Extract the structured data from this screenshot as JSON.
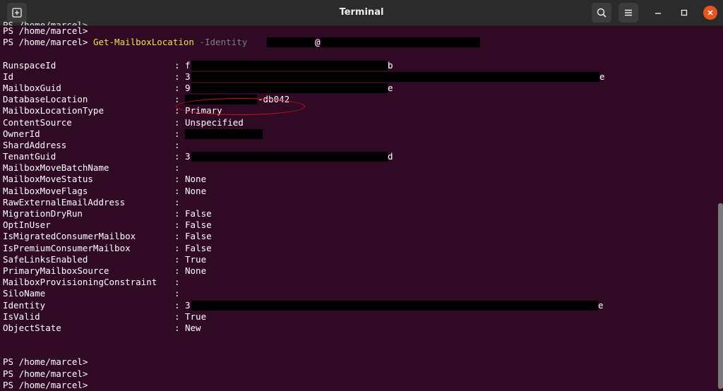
{
  "window": {
    "title": "Terminal"
  },
  "terminal": {
    "prompt": "PS /home/marcel>",
    "top_partial": "PS /home/marcel>",
    "cmd_name": "Get-MailboxLocation",
    "cmd_param": "-Identity",
    "cmd_at": "@",
    "rows": [
      {
        "key": "RunspaceId",
        "value": "f",
        "suffix": "b"
      },
      {
        "key": "Id",
        "value": "3",
        "suffix": "e"
      },
      {
        "key": "MailboxGuid",
        "value": "9",
        "suffix": "e"
      },
      {
        "key": "DatabaseLocation",
        "value": "",
        "suffix": "-db042"
      },
      {
        "key": "MailboxLocationType",
        "value": "Primary",
        "suffix": ""
      },
      {
        "key": "ContentSource",
        "value": "Unspecified",
        "suffix": ""
      },
      {
        "key": "OwnerId",
        "value": "",
        "suffix": ""
      },
      {
        "key": "ShardAddress",
        "value": "",
        "suffix": ""
      },
      {
        "key": "TenantGuid",
        "value": "3",
        "suffix": "d"
      },
      {
        "key": "MailboxMoveBatchName",
        "value": "",
        "suffix": ""
      },
      {
        "key": "MailboxMoveStatus",
        "value": "None",
        "suffix": ""
      },
      {
        "key": "MailboxMoveFlags",
        "value": "None",
        "suffix": ""
      },
      {
        "key": "RawExternalEmailAddress",
        "value": "",
        "suffix": ""
      },
      {
        "key": "MigrationDryRun",
        "value": "False",
        "suffix": ""
      },
      {
        "key": "OptInUser",
        "value": "False",
        "suffix": ""
      },
      {
        "key": "IsMigratedConsumerMailbox",
        "value": "False",
        "suffix": ""
      },
      {
        "key": "IsPremiumConsumerMailbox",
        "value": "False",
        "suffix": ""
      },
      {
        "key": "SafeLinksEnabled",
        "value": "True",
        "suffix": ""
      },
      {
        "key": "PrimaryMailboxSource",
        "value": "None",
        "suffix": ""
      },
      {
        "key": "MailboxProvisioningConstraint",
        "value": "",
        "suffix": ""
      },
      {
        "key": "SiloName",
        "value": "",
        "suffix": ""
      },
      {
        "key": "Identity",
        "value": "3",
        "suffix": "e"
      },
      {
        "key": "IsValid",
        "value": "True",
        "suffix": ""
      },
      {
        "key": "ObjectState",
        "value": "New",
        "suffix": ""
      }
    ]
  }
}
